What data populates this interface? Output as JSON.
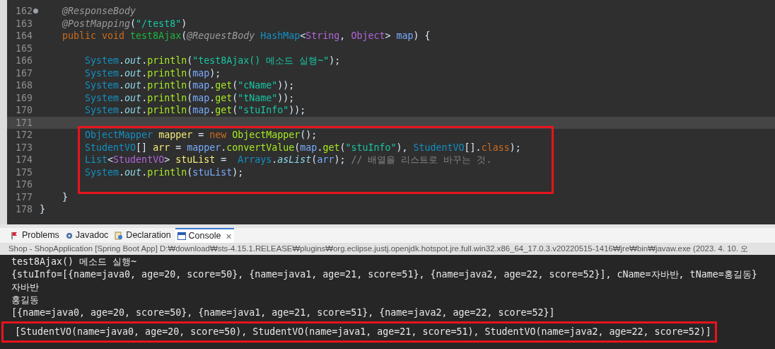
{
  "editor": {
    "lines": [
      {
        "number": "162",
        "marker": true,
        "current": false,
        "boxed": false,
        "tokens": [
          {
            "kind": "annotation",
            "text": "    @ResponseBody"
          }
        ]
      },
      {
        "number": "163",
        "marker": false,
        "current": false,
        "boxed": false,
        "tokens": [
          {
            "kind": "annotation",
            "text": "    @PostMapping"
          },
          {
            "kind": "plain",
            "text": "("
          },
          {
            "kind": "string",
            "text": "\"/test8\""
          },
          {
            "kind": "plain",
            "text": ")"
          }
        ]
      },
      {
        "number": "164",
        "marker": false,
        "current": false,
        "boxed": false,
        "tokens": [
          {
            "kind": "keyword",
            "text": "    public void "
          },
          {
            "kind": "decl",
            "text": "test8Ajax"
          },
          {
            "kind": "plain",
            "text": "("
          },
          {
            "kind": "annotation",
            "text": "@RequestBody "
          },
          {
            "kind": "type",
            "text": "HashMap"
          },
          {
            "kind": "plain",
            "text": "<"
          },
          {
            "kind": "generic",
            "text": "String"
          },
          {
            "kind": "plain",
            "text": ", "
          },
          {
            "kind": "generic",
            "text": "Object"
          },
          {
            "kind": "plain",
            "text": "> "
          },
          {
            "kind": "local",
            "text": "map"
          },
          {
            "kind": "plain",
            "text": ") {"
          }
        ]
      },
      {
        "number": "165",
        "marker": false,
        "current": false,
        "boxed": false
      },
      {
        "number": "166",
        "marker": false,
        "current": false,
        "boxed": false,
        "tokens": [
          {
            "kind": "type",
            "text": "        System"
          },
          {
            "kind": "plain",
            "text": "."
          },
          {
            "kind": "field",
            "text": "out"
          },
          {
            "kind": "plain",
            "text": "."
          },
          {
            "kind": "method",
            "text": "println"
          },
          {
            "kind": "plain",
            "text": "("
          },
          {
            "kind": "string",
            "text": "\"test8Ajax() 메소드 실행~\""
          },
          {
            "kind": "plain",
            "text": ");"
          }
        ]
      },
      {
        "number": "167",
        "marker": false,
        "current": false,
        "boxed": false,
        "tokens": [
          {
            "kind": "type",
            "text": "        System"
          },
          {
            "kind": "plain",
            "text": "."
          },
          {
            "kind": "field",
            "text": "out"
          },
          {
            "kind": "plain",
            "text": "."
          },
          {
            "kind": "method",
            "text": "println"
          },
          {
            "kind": "plain",
            "text": "("
          },
          {
            "kind": "local",
            "text": "map"
          },
          {
            "kind": "plain",
            "text": ");"
          }
        ]
      },
      {
        "number": "168",
        "marker": false,
        "current": false,
        "boxed": false,
        "tokens": [
          {
            "kind": "type",
            "text": "        System"
          },
          {
            "kind": "plain",
            "text": "."
          },
          {
            "kind": "field",
            "text": "out"
          },
          {
            "kind": "plain",
            "text": "."
          },
          {
            "kind": "method",
            "text": "println"
          },
          {
            "kind": "plain",
            "text": "("
          },
          {
            "kind": "local",
            "text": "map"
          },
          {
            "kind": "plain",
            "text": "."
          },
          {
            "kind": "method",
            "text": "get"
          },
          {
            "kind": "plain",
            "text": "("
          },
          {
            "kind": "string",
            "text": "\"cName\""
          },
          {
            "kind": "plain",
            "text": "));"
          }
        ]
      },
      {
        "number": "169",
        "marker": false,
        "current": false,
        "boxed": false,
        "tokens": [
          {
            "kind": "type",
            "text": "        System"
          },
          {
            "kind": "plain",
            "text": "."
          },
          {
            "kind": "field",
            "text": "out"
          },
          {
            "kind": "plain",
            "text": "."
          },
          {
            "kind": "method",
            "text": "println"
          },
          {
            "kind": "plain",
            "text": "("
          },
          {
            "kind": "local",
            "text": "map"
          },
          {
            "kind": "plain",
            "text": "."
          },
          {
            "kind": "method",
            "text": "get"
          },
          {
            "kind": "plain",
            "text": "("
          },
          {
            "kind": "string",
            "text": "\"tName\""
          },
          {
            "kind": "plain",
            "text": "));"
          }
        ]
      },
      {
        "number": "170",
        "marker": false,
        "current": false,
        "boxed": false,
        "tokens": [
          {
            "kind": "type",
            "text": "        System"
          },
          {
            "kind": "plain",
            "text": "."
          },
          {
            "kind": "field",
            "text": "out"
          },
          {
            "kind": "plain",
            "text": "."
          },
          {
            "kind": "method",
            "text": "println"
          },
          {
            "kind": "plain",
            "text": "("
          },
          {
            "kind": "local",
            "text": "map"
          },
          {
            "kind": "plain",
            "text": "."
          },
          {
            "kind": "method",
            "text": "get"
          },
          {
            "kind": "plain",
            "text": "("
          },
          {
            "kind": "string",
            "text": "\"stuInfo\""
          },
          {
            "kind": "plain",
            "text": "));"
          }
        ]
      },
      {
        "number": "171",
        "marker": false,
        "current": true,
        "boxed": false
      },
      {
        "number": "172",
        "marker": false,
        "current": false,
        "boxed": true,
        "tokens": [
          {
            "kind": "type",
            "text": "        ObjectMapper "
          },
          {
            "kind": "var",
            "text": "mapper"
          },
          {
            "kind": "plain",
            "text": " = "
          },
          {
            "kind": "keyword",
            "text": "new "
          },
          {
            "kind": "method",
            "text": "ObjectMapper"
          },
          {
            "kind": "plain",
            "text": "();"
          }
        ]
      },
      {
        "number": "173",
        "marker": false,
        "current": false,
        "boxed": true,
        "tokens": [
          {
            "kind": "type",
            "text": "        StudentVO"
          },
          {
            "kind": "plain",
            "text": "[] "
          },
          {
            "kind": "var",
            "text": "arr"
          },
          {
            "kind": "plain",
            "text": " = "
          },
          {
            "kind": "local",
            "text": "mapper"
          },
          {
            "kind": "plain",
            "text": "."
          },
          {
            "kind": "method",
            "text": "convertValue"
          },
          {
            "kind": "plain",
            "text": "("
          },
          {
            "kind": "local",
            "text": "map"
          },
          {
            "kind": "plain",
            "text": "."
          },
          {
            "kind": "method",
            "text": "get"
          },
          {
            "kind": "plain",
            "text": "("
          },
          {
            "kind": "string",
            "text": "\"stuInfo\""
          },
          {
            "kind": "plain",
            "text": "), "
          },
          {
            "kind": "type",
            "text": "StudentVO"
          },
          {
            "kind": "plain",
            "text": "[]."
          },
          {
            "kind": "keyword",
            "text": "class"
          },
          {
            "kind": "plain",
            "text": ");"
          }
        ]
      },
      {
        "number": "174",
        "marker": false,
        "current": false,
        "boxed": true,
        "tokens": [
          {
            "kind": "type",
            "text": "        List"
          },
          {
            "kind": "plain",
            "text": "<"
          },
          {
            "kind": "generic",
            "text": "StudentVO"
          },
          {
            "kind": "plain",
            "text": "> "
          },
          {
            "kind": "var",
            "text": "stuList"
          },
          {
            "kind": "plain",
            "text": " =  "
          },
          {
            "kind": "type",
            "text": "Arrays"
          },
          {
            "kind": "plain",
            "text": "."
          },
          {
            "kind": "static",
            "text": "asList"
          },
          {
            "kind": "plain",
            "text": "("
          },
          {
            "kind": "local",
            "text": "arr"
          },
          {
            "kind": "plain",
            "text": "); "
          },
          {
            "kind": "comment",
            "text": "// 배열을 리스트로 바꾸는 것."
          }
        ]
      },
      {
        "number": "175",
        "marker": false,
        "current": false,
        "boxed": true,
        "tokens": [
          {
            "kind": "type",
            "text": "        System"
          },
          {
            "kind": "plain",
            "text": "."
          },
          {
            "kind": "field",
            "text": "out"
          },
          {
            "kind": "plain",
            "text": "."
          },
          {
            "kind": "method",
            "text": "println"
          },
          {
            "kind": "plain",
            "text": "("
          },
          {
            "kind": "local",
            "text": "stuList"
          },
          {
            "kind": "plain",
            "text": ");"
          }
        ]
      },
      {
        "number": "176",
        "marker": false,
        "current": false,
        "boxed": true
      },
      {
        "number": "177",
        "marker": false,
        "current": false,
        "boxed": false,
        "tokens": [
          {
            "kind": "plain",
            "text": "    }"
          }
        ]
      },
      {
        "number": "178",
        "marker": false,
        "current": false,
        "boxed": false,
        "tokens": [
          {
            "kind": "plain",
            "text": "}"
          }
        ]
      }
    ]
  },
  "views": {
    "tabs": [
      {
        "label": "Problems",
        "kind": "problems",
        "selected": false
      },
      {
        "label": "Javadoc",
        "kind": "javadoc",
        "selected": false
      },
      {
        "label": "Declaration",
        "kind": "declaration",
        "selected": false
      },
      {
        "label": "Console",
        "kind": "console",
        "selected": true
      }
    ],
    "close": "×",
    "launch_info": "Shop - ShopApplication [Spring Boot App] D:₩download₩sts-4.15.1.RELEASE₩plugins₩org.eclipse.justj.openjdk.hotspot.jre.full.win32.x86_64_17.0.3.v20220515-1416₩jre₩bin₩javaw.exe  (2023. 4. 10. 오",
    "output": [
      {
        "text": "test8Ajax() 메소드 실행~",
        "boxed": false
      },
      {
        "text": "{stuInfo=[{name=java0, age=20, score=50}, {name=java1, age=21, score=51}, {name=java2, age=22, score=52}], cName=자바반, tName=홍길동}",
        "boxed": false
      },
      {
        "text": "자바반",
        "boxed": false
      },
      {
        "text": "홍길동",
        "boxed": false
      },
      {
        "text": "[{name=java0, age=20, score=50}, {name=java1, age=21, score=51}, {name=java2, age=22, score=52}]",
        "boxed": false
      },
      {
        "text": "[StudentVO(name=java0, age=20, score=50), StudentVO(name=java1, age=21, score=51), StudentVO(name=java2, age=22, score=52)]",
        "boxed": true
      }
    ]
  }
}
